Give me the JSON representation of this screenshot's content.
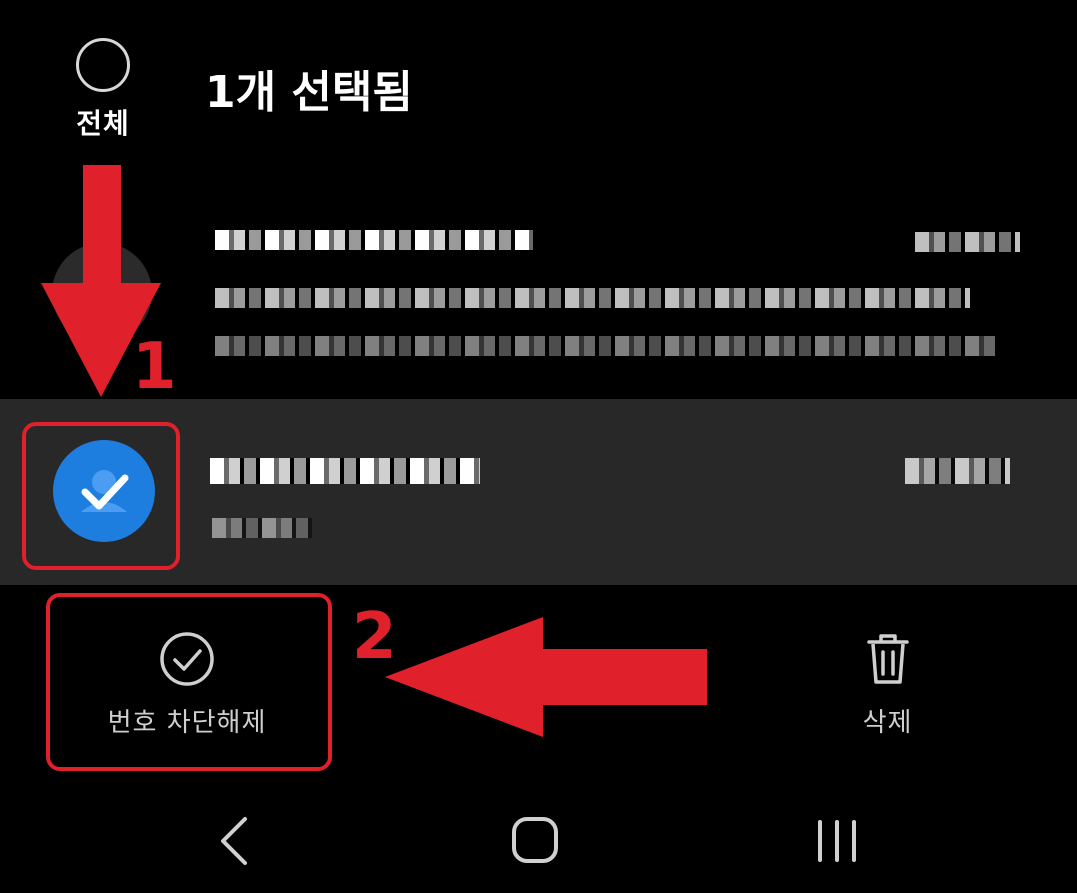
{
  "header": {
    "select_all_label": "전체",
    "title": "1개 선택됨"
  },
  "actions": {
    "unblock_label": "번호 차단해제",
    "delete_label": "삭제"
  },
  "annotations": {
    "step1": "1",
    "step2": "2",
    "accent_color": "#e0202a"
  },
  "icons": {
    "select_all": "circle-outline-icon",
    "selected": "check-icon",
    "unblock": "check-circle-icon",
    "delete": "trash-icon",
    "back": "chevron-left-icon",
    "home": "rounded-square-icon",
    "recents": "three-bars-icon"
  }
}
